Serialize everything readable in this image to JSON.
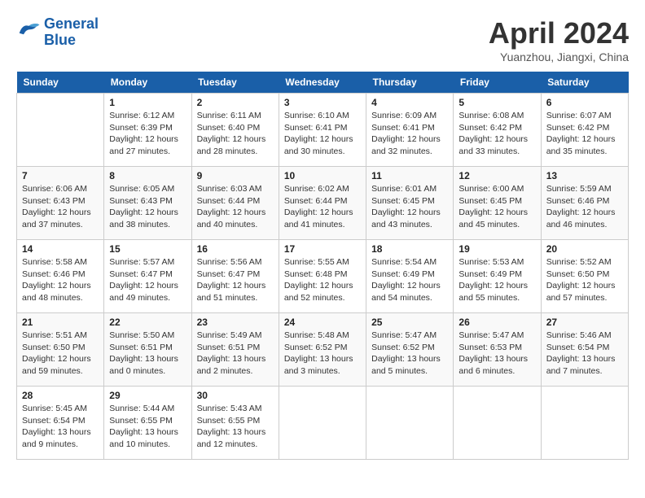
{
  "header": {
    "logo_line1": "General",
    "logo_line2": "Blue",
    "month_year": "April 2024",
    "location": "Yuanzhou, Jiangxi, China"
  },
  "weekdays": [
    "Sunday",
    "Monday",
    "Tuesday",
    "Wednesday",
    "Thursday",
    "Friday",
    "Saturday"
  ],
  "weeks": [
    [
      {
        "day": "",
        "info": ""
      },
      {
        "day": "1",
        "info": "Sunrise: 6:12 AM\nSunset: 6:39 PM\nDaylight: 12 hours\nand 27 minutes."
      },
      {
        "day": "2",
        "info": "Sunrise: 6:11 AM\nSunset: 6:40 PM\nDaylight: 12 hours\nand 28 minutes."
      },
      {
        "day": "3",
        "info": "Sunrise: 6:10 AM\nSunset: 6:41 PM\nDaylight: 12 hours\nand 30 minutes."
      },
      {
        "day": "4",
        "info": "Sunrise: 6:09 AM\nSunset: 6:41 PM\nDaylight: 12 hours\nand 32 minutes."
      },
      {
        "day": "5",
        "info": "Sunrise: 6:08 AM\nSunset: 6:42 PM\nDaylight: 12 hours\nand 33 minutes."
      },
      {
        "day": "6",
        "info": "Sunrise: 6:07 AM\nSunset: 6:42 PM\nDaylight: 12 hours\nand 35 minutes."
      }
    ],
    [
      {
        "day": "7",
        "info": "Sunrise: 6:06 AM\nSunset: 6:43 PM\nDaylight: 12 hours\nand 37 minutes."
      },
      {
        "day": "8",
        "info": "Sunrise: 6:05 AM\nSunset: 6:43 PM\nDaylight: 12 hours\nand 38 minutes."
      },
      {
        "day": "9",
        "info": "Sunrise: 6:03 AM\nSunset: 6:44 PM\nDaylight: 12 hours\nand 40 minutes."
      },
      {
        "day": "10",
        "info": "Sunrise: 6:02 AM\nSunset: 6:44 PM\nDaylight: 12 hours\nand 41 minutes."
      },
      {
        "day": "11",
        "info": "Sunrise: 6:01 AM\nSunset: 6:45 PM\nDaylight: 12 hours\nand 43 minutes."
      },
      {
        "day": "12",
        "info": "Sunrise: 6:00 AM\nSunset: 6:45 PM\nDaylight: 12 hours\nand 45 minutes."
      },
      {
        "day": "13",
        "info": "Sunrise: 5:59 AM\nSunset: 6:46 PM\nDaylight: 12 hours\nand 46 minutes."
      }
    ],
    [
      {
        "day": "14",
        "info": "Sunrise: 5:58 AM\nSunset: 6:46 PM\nDaylight: 12 hours\nand 48 minutes."
      },
      {
        "day": "15",
        "info": "Sunrise: 5:57 AM\nSunset: 6:47 PM\nDaylight: 12 hours\nand 49 minutes."
      },
      {
        "day": "16",
        "info": "Sunrise: 5:56 AM\nSunset: 6:47 PM\nDaylight: 12 hours\nand 51 minutes."
      },
      {
        "day": "17",
        "info": "Sunrise: 5:55 AM\nSunset: 6:48 PM\nDaylight: 12 hours\nand 52 minutes."
      },
      {
        "day": "18",
        "info": "Sunrise: 5:54 AM\nSunset: 6:49 PM\nDaylight: 12 hours\nand 54 minutes."
      },
      {
        "day": "19",
        "info": "Sunrise: 5:53 AM\nSunset: 6:49 PM\nDaylight: 12 hours\nand 55 minutes."
      },
      {
        "day": "20",
        "info": "Sunrise: 5:52 AM\nSunset: 6:50 PM\nDaylight: 12 hours\nand 57 minutes."
      }
    ],
    [
      {
        "day": "21",
        "info": "Sunrise: 5:51 AM\nSunset: 6:50 PM\nDaylight: 12 hours\nand 59 minutes."
      },
      {
        "day": "22",
        "info": "Sunrise: 5:50 AM\nSunset: 6:51 PM\nDaylight: 13 hours\nand 0 minutes."
      },
      {
        "day": "23",
        "info": "Sunrise: 5:49 AM\nSunset: 6:51 PM\nDaylight: 13 hours\nand 2 minutes."
      },
      {
        "day": "24",
        "info": "Sunrise: 5:48 AM\nSunset: 6:52 PM\nDaylight: 13 hours\nand 3 minutes."
      },
      {
        "day": "25",
        "info": "Sunrise: 5:47 AM\nSunset: 6:52 PM\nDaylight: 13 hours\nand 5 minutes."
      },
      {
        "day": "26",
        "info": "Sunrise: 5:47 AM\nSunset: 6:53 PM\nDaylight: 13 hours\nand 6 minutes."
      },
      {
        "day": "27",
        "info": "Sunrise: 5:46 AM\nSunset: 6:54 PM\nDaylight: 13 hours\nand 7 minutes."
      }
    ],
    [
      {
        "day": "28",
        "info": "Sunrise: 5:45 AM\nSunset: 6:54 PM\nDaylight: 13 hours\nand 9 minutes."
      },
      {
        "day": "29",
        "info": "Sunrise: 5:44 AM\nSunset: 6:55 PM\nDaylight: 13 hours\nand 10 minutes."
      },
      {
        "day": "30",
        "info": "Sunrise: 5:43 AM\nSunset: 6:55 PM\nDaylight: 13 hours\nand 12 minutes."
      },
      {
        "day": "",
        "info": ""
      },
      {
        "day": "",
        "info": ""
      },
      {
        "day": "",
        "info": ""
      },
      {
        "day": "",
        "info": ""
      }
    ]
  ]
}
